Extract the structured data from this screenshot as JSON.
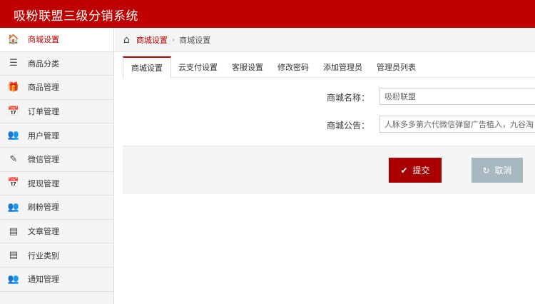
{
  "app": {
    "title": "吸粉联盟三级分销系统"
  },
  "colors": {
    "brand": "#c00000",
    "submit": "#a80000",
    "cancel": "#a8b8c0"
  },
  "sidebar": {
    "items": [
      {
        "label": "商城设置",
        "icon": "home-icon",
        "glyph": "🏠",
        "active": true
      },
      {
        "label": "商品分类",
        "icon": "list-icon",
        "glyph": "☰",
        "active": false
      },
      {
        "label": "商品管理",
        "icon": "gift-icon",
        "glyph": "🎁",
        "active": false
      },
      {
        "label": "订单管理",
        "icon": "calendar-icon",
        "glyph": "📅",
        "active": false
      },
      {
        "label": "用户管理",
        "icon": "users-icon",
        "glyph": "👥",
        "active": false
      },
      {
        "label": "微信管理",
        "icon": "edit-icon",
        "glyph": "✎",
        "active": false
      },
      {
        "label": "提现管理",
        "icon": "calendar-icon",
        "glyph": "📅",
        "active": false
      },
      {
        "label": "刷粉管理",
        "icon": "users-icon",
        "glyph": "👥",
        "active": false
      },
      {
        "label": "文章管理",
        "icon": "list-alt-icon",
        "glyph": "▤",
        "active": false
      },
      {
        "label": "行业类别",
        "icon": "list-alt-icon",
        "glyph": "▤",
        "active": false
      },
      {
        "label": "通知管理",
        "icon": "users-icon",
        "glyph": "👥",
        "active": false
      }
    ]
  },
  "breadcrumb": {
    "home_glyph": "⌂",
    "link": "商城设置",
    "separator": "›",
    "current": "商城设置"
  },
  "tabs": [
    {
      "label": "商城设置",
      "active": true
    },
    {
      "label": "云支付设置",
      "active": false
    },
    {
      "label": "客服设置",
      "active": false
    },
    {
      "label": "修改密码",
      "active": false
    },
    {
      "label": "添加管理员",
      "active": false
    },
    {
      "label": "管理员列表",
      "active": false
    }
  ],
  "form": {
    "name_label": "商城名称：",
    "name_value": "吸粉联盟",
    "notice_label": "商城公告：",
    "notice_value": "人脉多多第六代微信弹窗广告植入，九谷淘"
  },
  "actions": {
    "submit_label": "提交",
    "submit_glyph": "✔",
    "cancel_label": "取消",
    "cancel_glyph": "↻"
  }
}
